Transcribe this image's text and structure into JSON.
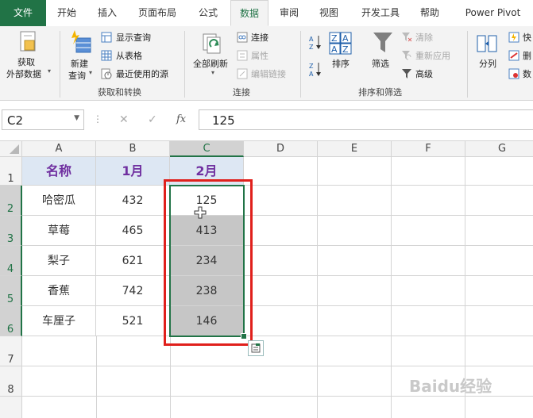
{
  "tabs": [
    "文件",
    "开始",
    "插入",
    "页面布局",
    "公式",
    "数据",
    "审阅",
    "视图",
    "开发工具",
    "帮助",
    "Power Pivot"
  ],
  "active_tab_index": 5,
  "ribbon": {
    "get_data": [
      "获取",
      "外部数据"
    ],
    "new_query": [
      "新建",
      "查询"
    ],
    "show_query": "显示查询",
    "from_table": "从表格",
    "recent_sources": "最近使用的源",
    "group_get_transform": "获取和转换",
    "refresh_all": "全部刷新",
    "connections": "连接",
    "properties": "属性",
    "edit_links": "编辑链接",
    "group_connections": "连接",
    "sort": "排序",
    "filter": "筛选",
    "clear": "清除",
    "reapply": "重新应用",
    "advanced": "高级",
    "group_sort_filter": "排序和筛选",
    "text_to_columns": "分列",
    "flash_fill": "快",
    "remove_dup": "删",
    "data_validation": "数"
  },
  "formula_bar": {
    "name_box": "C2",
    "cancel": "✕",
    "enter": "✓",
    "fx": "fx",
    "formula": "125"
  },
  "columns": [
    "A",
    "B",
    "C",
    "D",
    "E",
    "F",
    "G"
  ],
  "rows": [
    "1",
    "2",
    "3",
    "4",
    "5",
    "6",
    "7",
    "8"
  ],
  "sheet": {
    "headers": [
      "名称",
      "1月",
      "2月"
    ],
    "data": [
      [
        "哈密瓜",
        "432",
        "125"
      ],
      [
        "草莓",
        "465",
        "413"
      ],
      [
        "梨子",
        "621",
        "234"
      ],
      [
        "香蕉",
        "742",
        "238"
      ],
      [
        "车厘子",
        "521",
        "146"
      ]
    ]
  },
  "watermark": "Baidu经验",
  "colors": {
    "accent": "#217346",
    "highlight": "#e0201c",
    "header_fill": "#dde7f3",
    "header_text": "#7030a0"
  }
}
